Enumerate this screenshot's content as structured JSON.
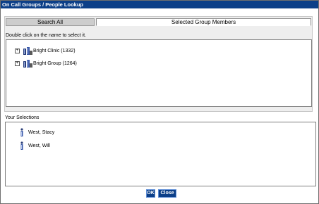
{
  "window": {
    "title": "On Call Groups / People Lookup"
  },
  "tabs": [
    {
      "label": "Search All",
      "active": false
    },
    {
      "label": "Selected Group Members",
      "active": true
    }
  ],
  "instruction": "Double click on the name to select it.",
  "groups": [
    {
      "label": "Bright Clinic (1332)",
      "expander": "+",
      "icon": "group-icon"
    },
    {
      "label": "Bright Group (1264)",
      "expander": "+",
      "icon": "group-icon"
    }
  ],
  "selections": {
    "label": "Your Selections",
    "items": [
      {
        "name": "West, Stacy",
        "icon": "person-icon"
      },
      {
        "name": "West, Will",
        "icon": "person-icon"
      }
    ]
  },
  "buttons": {
    "ok": "OK",
    "close": "Close"
  },
  "colors": {
    "titlebar": "#0c3f88",
    "button": "#0c3f88"
  }
}
